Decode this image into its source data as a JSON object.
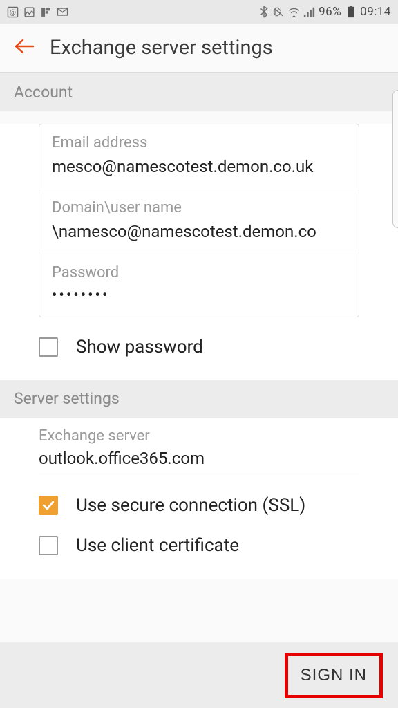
{
  "status_bar": {
    "battery_pct": "96%",
    "time": "09:14"
  },
  "header": {
    "title": "Exchange server settings"
  },
  "sections": {
    "account": {
      "header": "Account",
      "email_label": "Email address",
      "email_value": "mesco@namescotest.demon.co.uk",
      "domain_label": "Domain\\user name",
      "domain_value": "\\namesco@namescotest.demon.co",
      "password_label": "Password",
      "password_value": "••••••••",
      "show_password_label": "Show password",
      "show_password_checked": false
    },
    "server": {
      "header": "Server settings",
      "exchange_label": "Exchange server",
      "exchange_value": "outlook.office365.com",
      "ssl_label": "Use secure connection (SSL)",
      "ssl_checked": true,
      "client_cert_label": "Use client certificate",
      "client_cert_checked": false
    }
  },
  "footer": {
    "signin_label": "SIGN IN"
  }
}
